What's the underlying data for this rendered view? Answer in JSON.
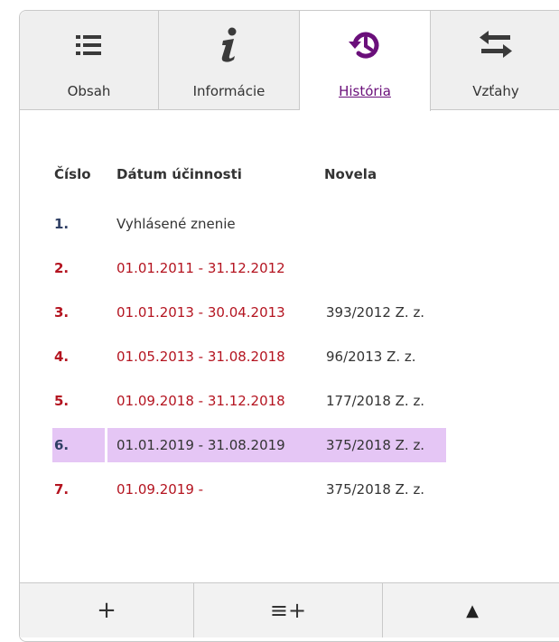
{
  "tabs": [
    {
      "label": "Obsah",
      "icon": "list-icon"
    },
    {
      "label": "Informácie",
      "icon": "info-icon"
    },
    {
      "label": "História",
      "icon": "history-icon",
      "active": true
    },
    {
      "label": "Vzťahy",
      "icon": "arrows-exchange-icon"
    }
  ],
  "history": {
    "headers": {
      "number": "Číslo",
      "date": "Dátum účinnosti",
      "novela": "Novela"
    },
    "rows": [
      {
        "number": "1.",
        "date": "Vyhlásené znenie",
        "novela": ""
      },
      {
        "number": "2.",
        "date": "01.01.2011 - 31.12.2012",
        "novela": ""
      },
      {
        "number": "3.",
        "date": "01.01.2013 - 30.04.2013",
        "novela": "393/2012 Z. z."
      },
      {
        "number": "4.",
        "date": "01.05.2013 - 31.08.2018",
        "novela": "96/2013 Z. z."
      },
      {
        "number": "5.",
        "date": "01.09.2018 - 31.12.2018",
        "novela": "177/2018 Z. z."
      },
      {
        "number": "6.",
        "date": "01.01.2019 - 31.08.2019",
        "novela": "375/2018 Z. z.",
        "highlighted": true
      },
      {
        "number": "7.",
        "date": "01.09.2019 -",
        "novela": "375/2018 Z. z."
      }
    ]
  },
  "toolbar": [
    {
      "icon": "plus-icon",
      "glyph": "+"
    },
    {
      "icon": "list-add-icon",
      "glyph": "≡+"
    },
    {
      "icon": "triangle-up-icon",
      "glyph": "▲"
    }
  ],
  "colors": {
    "accent": "#6a0f7a",
    "link_red": "#b41420",
    "highlight": "#e5c6f5",
    "tab_bg": "#efefef",
    "border": "#c9c9c9"
  }
}
